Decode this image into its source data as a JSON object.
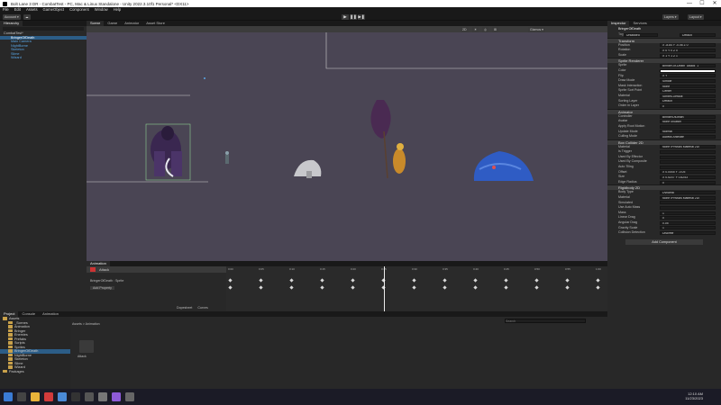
{
  "window": {
    "title": "Bolt Lane 3 DR - CombatTest - PC, Mac & Linux Standalone - Unity 2022.3.10f1 Personal* <DX11>",
    "controls": [
      "—",
      "☐",
      "✕"
    ]
  },
  "menu": [
    "File",
    "Edit",
    "Assets",
    "GameObject",
    "Component",
    "Window",
    "Help"
  ],
  "toolbar": {
    "left_buttons": [
      "Account ▾",
      "☁"
    ],
    "right_buttons": [
      "Layers ▾",
      "Layout ▾"
    ],
    "play_controls": [
      "▶",
      "❚❚",
      "▶❚"
    ]
  },
  "hierarchy": {
    "tab": "Hierarchy",
    "rows": [
      {
        "label": "CombatTest*",
        "selected": false,
        "blue": false
      },
      {
        "label": "BringerOfDeath",
        "selected": true,
        "blue": false
      },
      {
        "label": "Main Camera",
        "selected": false,
        "blue": true
      },
      {
        "label": "NightBorne",
        "selected": false,
        "blue": true
      },
      {
        "label": "Skeleton",
        "selected": false,
        "blue": true
      },
      {
        "label": "Slime",
        "selected": false,
        "blue": true
      },
      {
        "label": "Wizard",
        "selected": false,
        "blue": true
      }
    ]
  },
  "scene": {
    "tabs": [
      "Scene",
      "Game",
      "Animator",
      "Asset Store"
    ],
    "scenebar_buttons": [
      "2D",
      "☀",
      "◎",
      "⊞",
      "Gizmos ▾"
    ]
  },
  "animation": {
    "tab": "Animation",
    "clip": "Attack",
    "properties": [
      "BringerOfDeath : Sprite",
      "Add Property"
    ],
    "ticks": [
      "0:00",
      "0:05",
      "0:10",
      "0:15",
      "0:20",
      "0:25",
      "0:30",
      "0:35",
      "0:40",
      "0:45",
      "0:50",
      "0:55",
      "1:00"
    ],
    "bottom_tabs": [
      "Dopesheet",
      "Curves"
    ]
  },
  "project": {
    "tabs": [
      "Project",
      "Console",
      "Animation"
    ],
    "breadcrumb": "Assets > Animation",
    "search_placeholder": "Search",
    "folders": [
      "Assets",
      "_Scenes",
      "Animation",
      "Bringer",
      "Enemies",
      "Prefabs",
      "Scripts",
      "Sprites",
      "BringerOfDeath",
      "NightBorne",
      "Skeleton",
      "Slime",
      "Wizard",
      "Packages"
    ],
    "asset_label": "Attack"
  },
  "inspector": {
    "tabs": [
      "Inspector",
      "Services"
    ],
    "object_name": "BringerOfDeath",
    "tag_value": "Untagged",
    "layer_value": "Default",
    "sections": [
      {
        "title": "Transform",
        "rows": [
          [
            "Position",
            "X -8.84 Y -0.06 Z 0"
          ],
          [
            "Rotation",
            "X 0  Y 0  Z 0"
          ],
          [
            "Scale",
            "X 1  Y 1  Z 1"
          ]
        ]
      },
      {
        "title": "Sprite Renderer",
        "rows": [
          [
            "Sprite",
            "Bringer-of-Death_Attack_1"
          ],
          [
            "Color",
            ""
          ],
          [
            "Flip",
            "X  Y"
          ],
          [
            "Draw Mode",
            "Simple"
          ],
          [
            "Mask Interaction",
            "None"
          ],
          [
            "Sprite Sort Point",
            "Center"
          ],
          [
            "Material",
            "Sprites-Default"
          ],
          [
            "Sorting Layer",
            "Default"
          ],
          [
            "Order in Layer",
            "0"
          ]
        ]
      },
      {
        "title": "Animator",
        "rows": [
          [
            "Controller",
            "BringerOfDeath"
          ],
          [
            "Avatar",
            "None (Avatar)"
          ],
          [
            "Apply Root Motion",
            ""
          ],
          [
            "Update Mode",
            "Normal"
          ],
          [
            "Culling Mode",
            "Always Animate"
          ]
        ]
      },
      {
        "title": "Box Collider 2D",
        "rows": [
          [
            "Material",
            "None (Physics Material 2D)"
          ],
          [
            "Is Trigger",
            ""
          ],
          [
            "Used By Effector",
            ""
          ],
          [
            "Used By Composite",
            ""
          ],
          [
            "Auto Tiling",
            ""
          ],
          [
            "Offset",
            "X 0.0045  Y -0.05"
          ],
          [
            "Size",
            "X 0.5207  Y 0.8253"
          ],
          [
            "Edge Radius",
            "0"
          ]
        ]
      },
      {
        "title": "Rigidbody 2D",
        "rows": [
          [
            "Body Type",
            "Dynamic"
          ],
          [
            "Material",
            "None (Physics Material 2D)"
          ],
          [
            "Simulated",
            ""
          ],
          [
            "Use Auto Mass",
            ""
          ],
          [
            "Mass",
            "1"
          ],
          [
            "Linear Drag",
            "0"
          ],
          [
            "Angular Drag",
            "0.05"
          ],
          [
            "Gravity Scale",
            "1"
          ],
          [
            "Collision Detection",
            "Discrete"
          ]
        ]
      }
    ],
    "footer": "Add Component"
  },
  "taskbar": {
    "time": "12:10 AM",
    "date": "11/23/2023",
    "icon_colors": [
      "#3a7bd5",
      "#444",
      "#e8b33a",
      "#d23b3b",
      "#4a8ad6",
      "#333",
      "#555",
      "#777",
      "#8e5bd8",
      "#666"
    ]
  }
}
